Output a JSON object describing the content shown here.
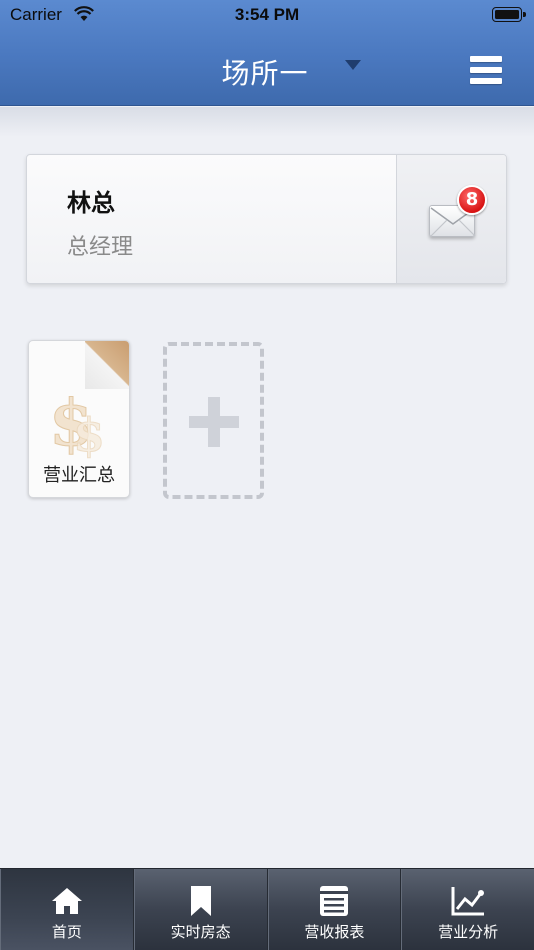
{
  "status_bar": {
    "carrier": "Carrier",
    "time": "3:54 PM"
  },
  "nav": {
    "title": "场所一",
    "menu_icon": "hamburger-menu-icon"
  },
  "user_card": {
    "name": "林总",
    "role": "总经理",
    "unread_count": "8",
    "mail_icon": "envelope-icon"
  },
  "tiles": [
    {
      "label": "营业汇总",
      "icon": "dollar-document-icon"
    }
  ],
  "add_tile": {
    "icon": "plus-icon"
  },
  "tabs": [
    {
      "label": "首页",
      "icon": "home-icon",
      "active": true
    },
    {
      "label": "实时房态",
      "icon": "bookmark-icon",
      "active": false
    },
    {
      "label": "营收报表",
      "icon": "report-icon",
      "active": false
    },
    {
      "label": "营业分析",
      "icon": "line-chart-icon",
      "active": false
    }
  ],
  "colors": {
    "nav_blue": "#4a78bf",
    "badge_red": "#d81414",
    "tabbar_dark": "#3c4350",
    "background": "#eef0f5"
  }
}
